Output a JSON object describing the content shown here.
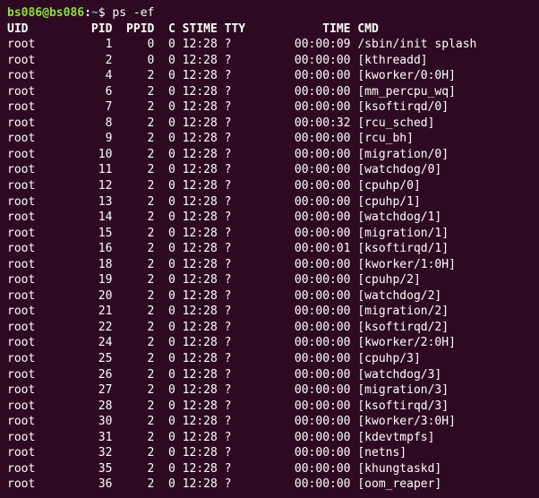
{
  "prompt": {
    "user": "bs086",
    "host": "bs086",
    "path": "~",
    "symbol": "$",
    "command": "ps -ef"
  },
  "columns": [
    "UID",
    "PID",
    "PPID",
    "C",
    "STIME",
    "TTY",
    "TIME",
    "CMD"
  ],
  "widths": {
    "uid": 8,
    "pid": 7,
    "ppid": 6,
    "c": 3,
    "stime": 6,
    "tty": 9,
    "time": 9,
    "cmd": 0
  },
  "rows": [
    {
      "uid": "root",
      "pid": "1",
      "ppid": "0",
      "c": "0",
      "stime": "12:28",
      "tty": "?",
      "time": "00:00:09",
      "cmd": "/sbin/init splash"
    },
    {
      "uid": "root",
      "pid": "2",
      "ppid": "0",
      "c": "0",
      "stime": "12:28",
      "tty": "?",
      "time": "00:00:00",
      "cmd": "[kthreadd]"
    },
    {
      "uid": "root",
      "pid": "4",
      "ppid": "2",
      "c": "0",
      "stime": "12:28",
      "tty": "?",
      "time": "00:00:00",
      "cmd": "[kworker/0:0H]"
    },
    {
      "uid": "root",
      "pid": "6",
      "ppid": "2",
      "c": "0",
      "stime": "12:28",
      "tty": "?",
      "time": "00:00:00",
      "cmd": "[mm_percpu_wq]"
    },
    {
      "uid": "root",
      "pid": "7",
      "ppid": "2",
      "c": "0",
      "stime": "12:28",
      "tty": "?",
      "time": "00:00:00",
      "cmd": "[ksoftirqd/0]"
    },
    {
      "uid": "root",
      "pid": "8",
      "ppid": "2",
      "c": "0",
      "stime": "12:28",
      "tty": "?",
      "time": "00:00:32",
      "cmd": "[rcu_sched]"
    },
    {
      "uid": "root",
      "pid": "9",
      "ppid": "2",
      "c": "0",
      "stime": "12:28",
      "tty": "?",
      "time": "00:00:00",
      "cmd": "[rcu_bh]"
    },
    {
      "uid": "root",
      "pid": "10",
      "ppid": "2",
      "c": "0",
      "stime": "12:28",
      "tty": "?",
      "time": "00:00:00",
      "cmd": "[migration/0]"
    },
    {
      "uid": "root",
      "pid": "11",
      "ppid": "2",
      "c": "0",
      "stime": "12:28",
      "tty": "?",
      "time": "00:00:00",
      "cmd": "[watchdog/0]"
    },
    {
      "uid": "root",
      "pid": "12",
      "ppid": "2",
      "c": "0",
      "stime": "12:28",
      "tty": "?",
      "time": "00:00:00",
      "cmd": "[cpuhp/0]"
    },
    {
      "uid": "root",
      "pid": "13",
      "ppid": "2",
      "c": "0",
      "stime": "12:28",
      "tty": "?",
      "time": "00:00:00",
      "cmd": "[cpuhp/1]"
    },
    {
      "uid": "root",
      "pid": "14",
      "ppid": "2",
      "c": "0",
      "stime": "12:28",
      "tty": "?",
      "time": "00:00:00",
      "cmd": "[watchdog/1]"
    },
    {
      "uid": "root",
      "pid": "15",
      "ppid": "2",
      "c": "0",
      "stime": "12:28",
      "tty": "?",
      "time": "00:00:00",
      "cmd": "[migration/1]"
    },
    {
      "uid": "root",
      "pid": "16",
      "ppid": "2",
      "c": "0",
      "stime": "12:28",
      "tty": "?",
      "time": "00:00:01",
      "cmd": "[ksoftirqd/1]"
    },
    {
      "uid": "root",
      "pid": "18",
      "ppid": "2",
      "c": "0",
      "stime": "12:28",
      "tty": "?",
      "time": "00:00:00",
      "cmd": "[kworker/1:0H]"
    },
    {
      "uid": "root",
      "pid": "19",
      "ppid": "2",
      "c": "0",
      "stime": "12:28",
      "tty": "?",
      "time": "00:00:00",
      "cmd": "[cpuhp/2]"
    },
    {
      "uid": "root",
      "pid": "20",
      "ppid": "2",
      "c": "0",
      "stime": "12:28",
      "tty": "?",
      "time": "00:00:00",
      "cmd": "[watchdog/2]"
    },
    {
      "uid": "root",
      "pid": "21",
      "ppid": "2",
      "c": "0",
      "stime": "12:28",
      "tty": "?",
      "time": "00:00:00",
      "cmd": "[migration/2]"
    },
    {
      "uid": "root",
      "pid": "22",
      "ppid": "2",
      "c": "0",
      "stime": "12:28",
      "tty": "?",
      "time": "00:00:00",
      "cmd": "[ksoftirqd/2]"
    },
    {
      "uid": "root",
      "pid": "24",
      "ppid": "2",
      "c": "0",
      "stime": "12:28",
      "tty": "?",
      "time": "00:00:00",
      "cmd": "[kworker/2:0H]"
    },
    {
      "uid": "root",
      "pid": "25",
      "ppid": "2",
      "c": "0",
      "stime": "12:28",
      "tty": "?",
      "time": "00:00:00",
      "cmd": "[cpuhp/3]"
    },
    {
      "uid": "root",
      "pid": "26",
      "ppid": "2",
      "c": "0",
      "stime": "12:28",
      "tty": "?",
      "time": "00:00:00",
      "cmd": "[watchdog/3]"
    },
    {
      "uid": "root",
      "pid": "27",
      "ppid": "2",
      "c": "0",
      "stime": "12:28",
      "tty": "?",
      "time": "00:00:00",
      "cmd": "[migration/3]"
    },
    {
      "uid": "root",
      "pid": "28",
      "ppid": "2",
      "c": "0",
      "stime": "12:28",
      "tty": "?",
      "time": "00:00:00",
      "cmd": "[ksoftirqd/3]"
    },
    {
      "uid": "root",
      "pid": "30",
      "ppid": "2",
      "c": "0",
      "stime": "12:28",
      "tty": "?",
      "time": "00:00:00",
      "cmd": "[kworker/3:0H]"
    },
    {
      "uid": "root",
      "pid": "31",
      "ppid": "2",
      "c": "0",
      "stime": "12:28",
      "tty": "?",
      "time": "00:00:00",
      "cmd": "[kdevtmpfs]"
    },
    {
      "uid": "root",
      "pid": "32",
      "ppid": "2",
      "c": "0",
      "stime": "12:28",
      "tty": "?",
      "time": "00:00:00",
      "cmd": "[netns]"
    },
    {
      "uid": "root",
      "pid": "35",
      "ppid": "2",
      "c": "0",
      "stime": "12:28",
      "tty": "?",
      "time": "00:00:00",
      "cmd": "[khungtaskd]"
    },
    {
      "uid": "root",
      "pid": "36",
      "ppid": "2",
      "c": "0",
      "stime": "12:28",
      "tty": "?",
      "time": "00:00:00",
      "cmd": "[oom_reaper]"
    }
  ]
}
